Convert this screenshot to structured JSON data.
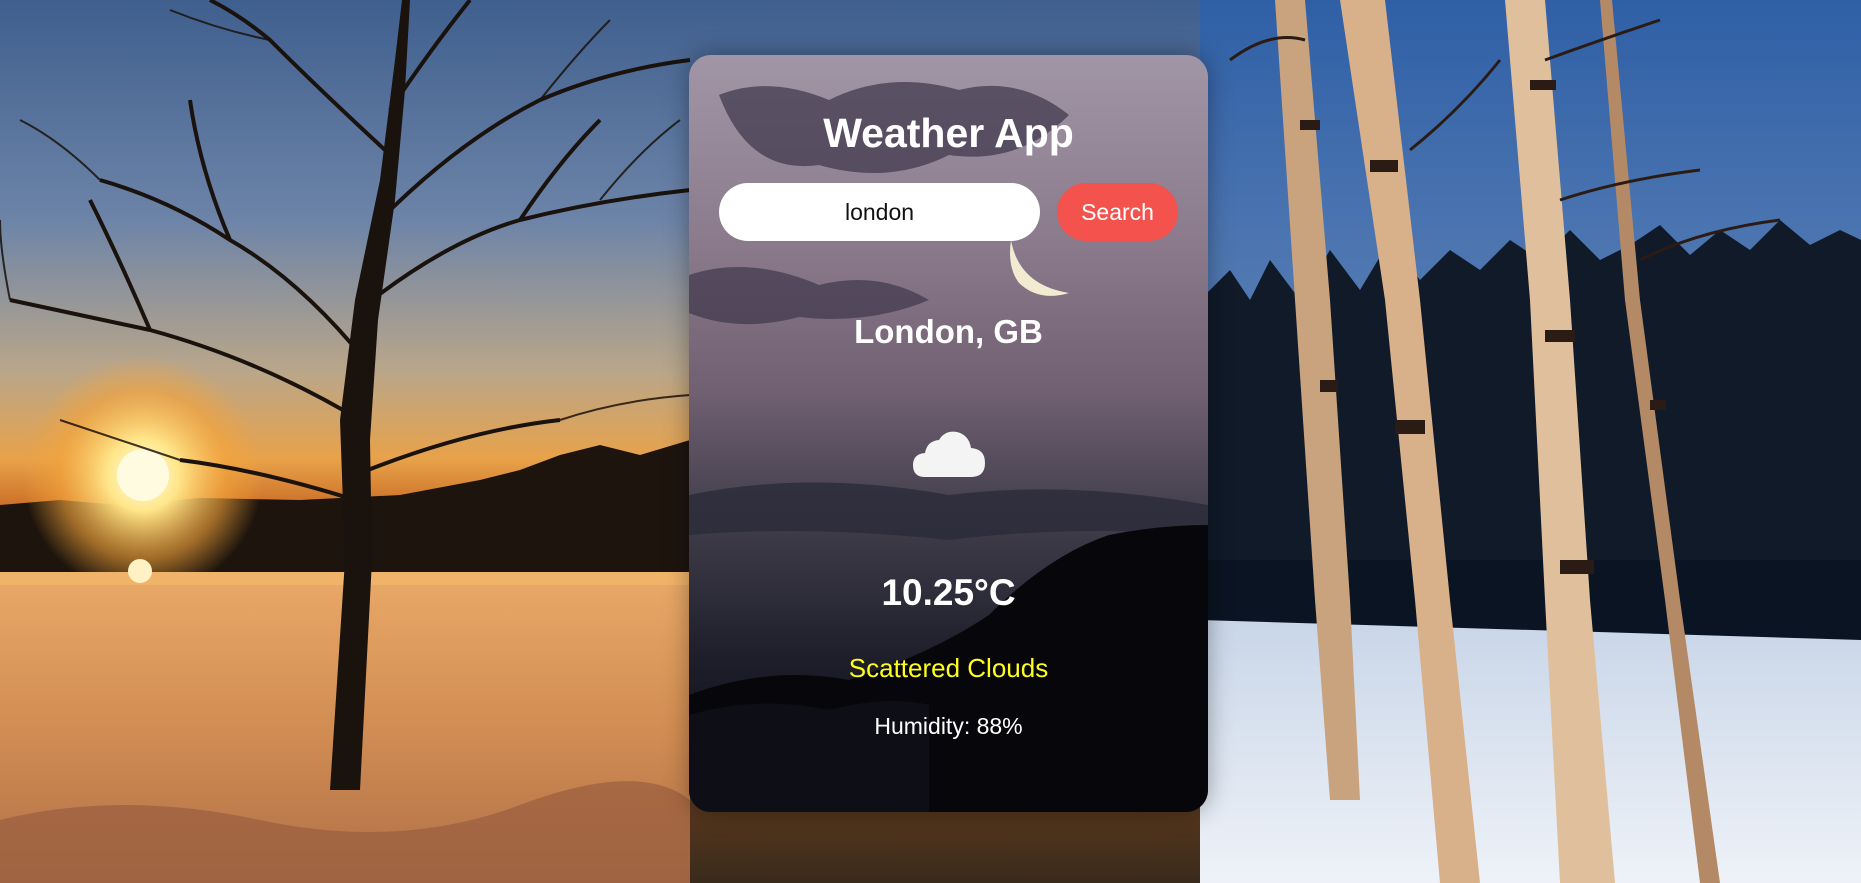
{
  "app": {
    "title": "Weather App"
  },
  "search": {
    "value": "london",
    "button_label": "Search"
  },
  "weather": {
    "location": "London, GB",
    "icon": "cloud-icon",
    "temperature": "10.25°C",
    "description": "Scattered Clouds",
    "humidity": "Humidity: 88%"
  },
  "colors": {
    "search_button": "#f4524d",
    "description_text": "#ffff1a",
    "card_top": "#9a8ea0",
    "card_bottom": "#0b0b12"
  }
}
